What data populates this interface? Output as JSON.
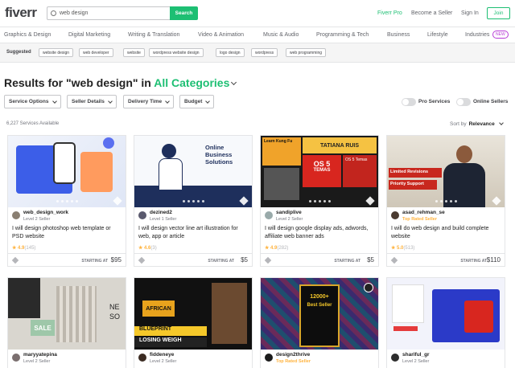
{
  "header": {
    "logo": "fiverr",
    "search_value": "web design",
    "search_button": "Search",
    "fiverr_pro": "Fiverr Pro",
    "become_seller": "Become a Seller",
    "sign_in": "Sign In",
    "join": "Join"
  },
  "categories": [
    "Graphics & Design",
    "Digital Marketing",
    "Writing & Translation",
    "Video & Animation",
    "Music & Audio",
    "Programming & Tech",
    "Business",
    "Lifestyle",
    "Industries"
  ],
  "new_badge": "NEW",
  "suggested": {
    "label": "Suggested",
    "tags": [
      "website design",
      "web developer",
      "website",
      "wordpress website design",
      "logo design",
      "wordpress",
      "web programming"
    ]
  },
  "results": {
    "prefix": "Results for \"web design\" in ",
    "category": "All Categories"
  },
  "filters": [
    "Service Options",
    "Seller Details",
    "Delivery Time",
    "Budget"
  ],
  "toggles": [
    "Pro Services",
    "Online Sellers"
  ],
  "services_count": "6,227 Services Available",
  "sort": {
    "label": "Sort by",
    "value": "Relevance"
  },
  "gigs": [
    {
      "user": "web_design_work",
      "level": "Level 2 Seller",
      "title": "I will design photoshop web template or PSD website",
      "rating": "4.9",
      "count": "(145)",
      "starting": "STARTING AT",
      "price": "$95"
    },
    {
      "user": "dezined2",
      "level": "Level 1 Seller",
      "title": "I will design vector line art illustration for web, app or article",
      "rating": "4.6",
      "count": "(3)",
      "starting": "STARTING AT",
      "price": "$5"
    },
    {
      "user": "sandiplive",
      "level": "Level 2 Seller",
      "title": "I will design google display ads, adwords, affiliate web banner ads",
      "rating": "4.9",
      "count": "(282)",
      "starting": "STARTING AT",
      "price": "$5"
    },
    {
      "user": "asad_rehman_se",
      "level": "Top Rated Seller",
      "title": "I will do web design and build complete website",
      "rating": "5.0",
      "count": "(513)",
      "starting": "STARTING AT",
      "price": "$110"
    },
    {
      "user": "maryyatepina",
      "level": "Level 2 Seller"
    },
    {
      "user": "fiddeneye",
      "level": "Level 2 Seller"
    },
    {
      "user": "design2thrive",
      "level": "Top Rated Seller"
    },
    {
      "user": "shariful_gr",
      "level": "Level 2 Seller"
    }
  ],
  "thumb_text": {
    "g2": [
      "Online Business",
      "Solutions"
    ],
    "g3": [
      "Learn Kung Fu",
      "TATIANA RUIS",
      "OS 5",
      "TEMAS",
      "OS 5 Temas"
    ],
    "g4": [
      "Limited Revisions",
      "Priority Support"
    ],
    "g5": [
      "SALE",
      "NE",
      "SO"
    ],
    "g6": [
      "AFRICAN",
      "BLUEPRINT",
      "LOSING WEIGH"
    ],
    "g7": [
      "12000+",
      "Best Seller"
    ]
  }
}
